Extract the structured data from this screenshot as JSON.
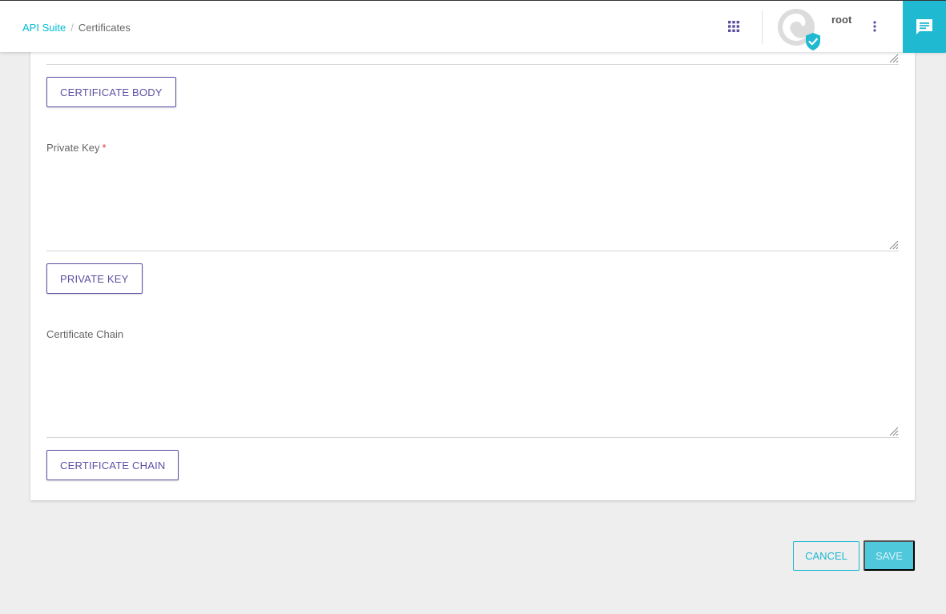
{
  "header": {
    "breadcrumb": {
      "root": "API Suite",
      "separator": "/",
      "current": "Certificates"
    },
    "apps_icon": "apps-grid-icon",
    "user": {
      "name": "root",
      "avatar_icon": "user-avatar-icon",
      "verified_badge_icon": "verified-check-icon"
    },
    "more_icon": "more-vertical-icon",
    "chat_icon": "chat-message-icon"
  },
  "form": {
    "certificate_body_button": "CERTIFICATE BODY",
    "private_key": {
      "label": "Private Key",
      "required_mark": "*",
      "value": "",
      "button": "PRIVATE KEY"
    },
    "certificate_chain": {
      "label": "Certificate Chain",
      "value": "",
      "button": "CERTIFICATE CHAIN"
    }
  },
  "actions": {
    "cancel": "CANCEL",
    "save": "SAVE"
  },
  "colors": {
    "accent": "#1fb9d1",
    "primary_purple": "#5e4fa2",
    "required": "#e53935",
    "background": "#eeeeee"
  }
}
